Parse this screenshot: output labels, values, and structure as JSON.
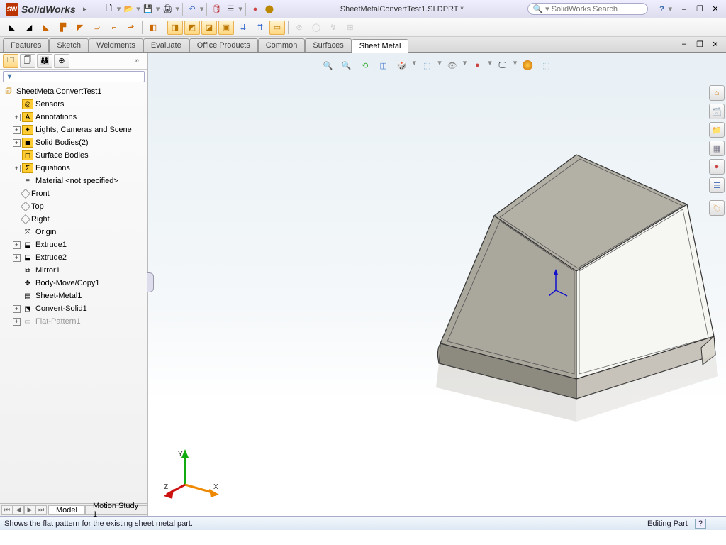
{
  "app": {
    "name": "SolidWorks"
  },
  "document": {
    "title": "SheetMetalConvertTest1.SLDPRT *"
  },
  "search": {
    "placeholder": "SolidWorks Search"
  },
  "tabs": [
    {
      "label": "Features"
    },
    {
      "label": "Sketch"
    },
    {
      "label": "Weldments"
    },
    {
      "label": "Evaluate"
    },
    {
      "label": "Office Products"
    },
    {
      "label": "Common"
    },
    {
      "label": "Surfaces"
    },
    {
      "label": "Sheet Metal"
    }
  ],
  "tree": {
    "root": "SheetMetalConvertTest1",
    "items": [
      {
        "label": "Sensors",
        "icon": "sensor",
        "exp": false,
        "level": 2
      },
      {
        "label": "Annotations",
        "icon": "ann",
        "exp": true,
        "level": 2
      },
      {
        "label": "Lights, Cameras and Scene",
        "icon": "lights",
        "exp": true,
        "level": 2
      },
      {
        "label": "Solid Bodies(2)",
        "icon": "solid",
        "exp": true,
        "level": 2
      },
      {
        "label": "Surface Bodies",
        "icon": "surf",
        "exp": false,
        "level": 2
      },
      {
        "label": "Equations",
        "icon": "eq",
        "exp": true,
        "level": 2
      },
      {
        "label": "Material <not specified>",
        "icon": "mat",
        "exp": false,
        "level": 2
      },
      {
        "label": "Front",
        "icon": "plane",
        "exp": false,
        "level": 2
      },
      {
        "label": "Top",
        "icon": "plane",
        "exp": false,
        "level": 2
      },
      {
        "label": "Right",
        "icon": "plane",
        "exp": false,
        "level": 2
      },
      {
        "label": "Origin",
        "icon": "origin",
        "exp": false,
        "level": 2
      },
      {
        "label": "Extrude1",
        "icon": "ext",
        "exp": true,
        "level": 2
      },
      {
        "label": "Extrude2",
        "icon": "ext",
        "exp": true,
        "level": 2
      },
      {
        "label": "Mirror1",
        "icon": "mirror",
        "exp": false,
        "level": 2
      },
      {
        "label": "Body-Move/Copy1",
        "icon": "move",
        "exp": false,
        "level": 2
      },
      {
        "label": "Sheet-Metal1",
        "icon": "sm",
        "exp": false,
        "level": 2
      },
      {
        "label": "Convert-Solid1",
        "icon": "conv",
        "exp": true,
        "level": 2
      },
      {
        "label": "Flat-Pattern1",
        "icon": "flat",
        "exp": true,
        "level": 2,
        "grey": true
      }
    ]
  },
  "bottom_tabs": [
    {
      "label": "Model"
    },
    {
      "label": "Motion Study 1"
    }
  ],
  "triad": {
    "x": "X",
    "y": "Y",
    "z": "Z"
  },
  "status": {
    "hint": "Shows the flat pattern for the existing sheet metal part.",
    "mode": "Editing Part",
    "help": "?"
  },
  "icons": {
    "help": "?",
    "min": "–",
    "restore": "❐",
    "close": "✕",
    "new": "🗋",
    "open": "📂",
    "save": "💾",
    "print": "🖨",
    "undo": "↶",
    "redo": "↷",
    "filter": "▼",
    "mag": "🔍",
    "chev": "»"
  }
}
